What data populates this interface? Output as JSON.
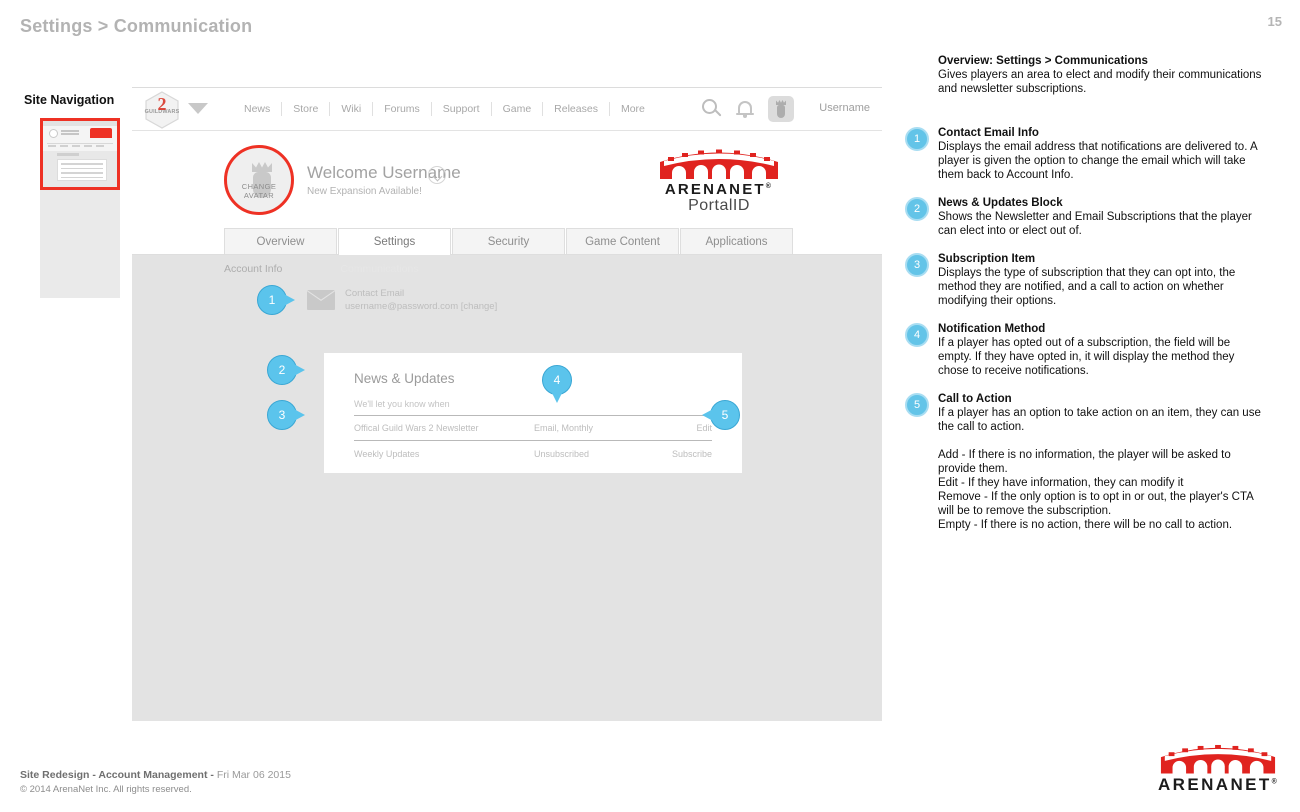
{
  "deck": {
    "title": "Settings > Communication",
    "page_number": "15",
    "footer_project": "Site Redesign - Account Management - ",
    "footer_date": "Fri Mar 06 2015",
    "footer_copyright": "© 2014 ArenaNet Inc. All rights reserved."
  },
  "sitenav": {
    "label": "Site Navigation"
  },
  "site_header": {
    "logo_alt": "guild-wars-2-logo",
    "nav": [
      "News",
      "Store",
      "Wiki",
      "Forums",
      "Support",
      "Game",
      "Releases",
      "More"
    ],
    "search_icon": "search-icon",
    "bell_icon": "notifications-bell-icon",
    "avatar_icon": "user-avatar-icon",
    "username": "Username"
  },
  "welcome": {
    "avatar_label": "CHANGE AVATAR",
    "title": "Welcome Username",
    "subtitle": "New Expansion Available!",
    "caret_icon": "chevron-down-icon",
    "brand_name": "ARENANET",
    "brand_reg": "®",
    "brand_product": "PortalID"
  },
  "tabs": [
    {
      "label": "Overview",
      "active": false
    },
    {
      "label": "Settings",
      "active": true
    },
    {
      "label": "Security",
      "active": false
    },
    {
      "label": "Game Content",
      "active": false
    },
    {
      "label": "Applications",
      "active": false
    }
  ],
  "subnav": [
    {
      "label": "Account Info",
      "active": false
    },
    {
      "label": "Communications",
      "active": true
    }
  ],
  "contact": {
    "icon": "envelope-icon",
    "label": "Contact Email",
    "value": "username@password.com [change]"
  },
  "news_card": {
    "title": "News & Updates",
    "subtitle": "We'll let you know when",
    "rows": [
      {
        "name": "Offical Guild Wars 2 Newsletter",
        "method": "Email, Monthly",
        "cta": "Edit"
      },
      {
        "name": "Weekly Updates",
        "method": "Unsubscribed",
        "cta": "Subscribe"
      }
    ]
  },
  "markers": {
    "m1": "1",
    "m2": "2",
    "m3": "3",
    "m4": "4",
    "m5": "5"
  },
  "notes": {
    "overview": {
      "title": "Overview: Settings > Communications",
      "body": "Gives players an area to elect and modify their communications and newsletter subscriptions."
    },
    "items": [
      {
        "num": "1",
        "title": "Contact Email Info",
        "body": "Displays the email address that notifications are delivered to.  A player is given the option to change the email which will take them back to Account Info."
      },
      {
        "num": "2",
        "title": "News & Updates Block",
        "body": "Shows the Newsletter and Email Subscriptions that the player can elect into or elect out of."
      },
      {
        "num": "3",
        "title": "Subscription Item",
        "body": "Displays the type of subscription that they can opt into, the method they are notified, and a call to action on whether modifying their options."
      },
      {
        "num": "4",
        "title": "Notification Method",
        "body": "If a player has opted out of a subscription, the field will be empty.  If they have opted in, it will display the method they chose to receive notifications."
      },
      {
        "num": "5",
        "title": "Call to Action",
        "body": "If a player has an option to take action on an item, they can use the call to action.",
        "body2": "Add - If there is no information, the player will be asked to provide them.\nEdit - If they have information, they can modify it\nRemove - If the only option is to opt in or out, the player's CTA will be to remove the subscription.\nEmpty - If there is no action, there will be no call to action."
      }
    ]
  },
  "brand_footer": {
    "name": "ARENANET",
    "reg": "®"
  },
  "colors": {
    "accent_blue": "#5bc4ec",
    "brand_red": "#ee3124",
    "panel_grey": "#e3e3e3"
  }
}
